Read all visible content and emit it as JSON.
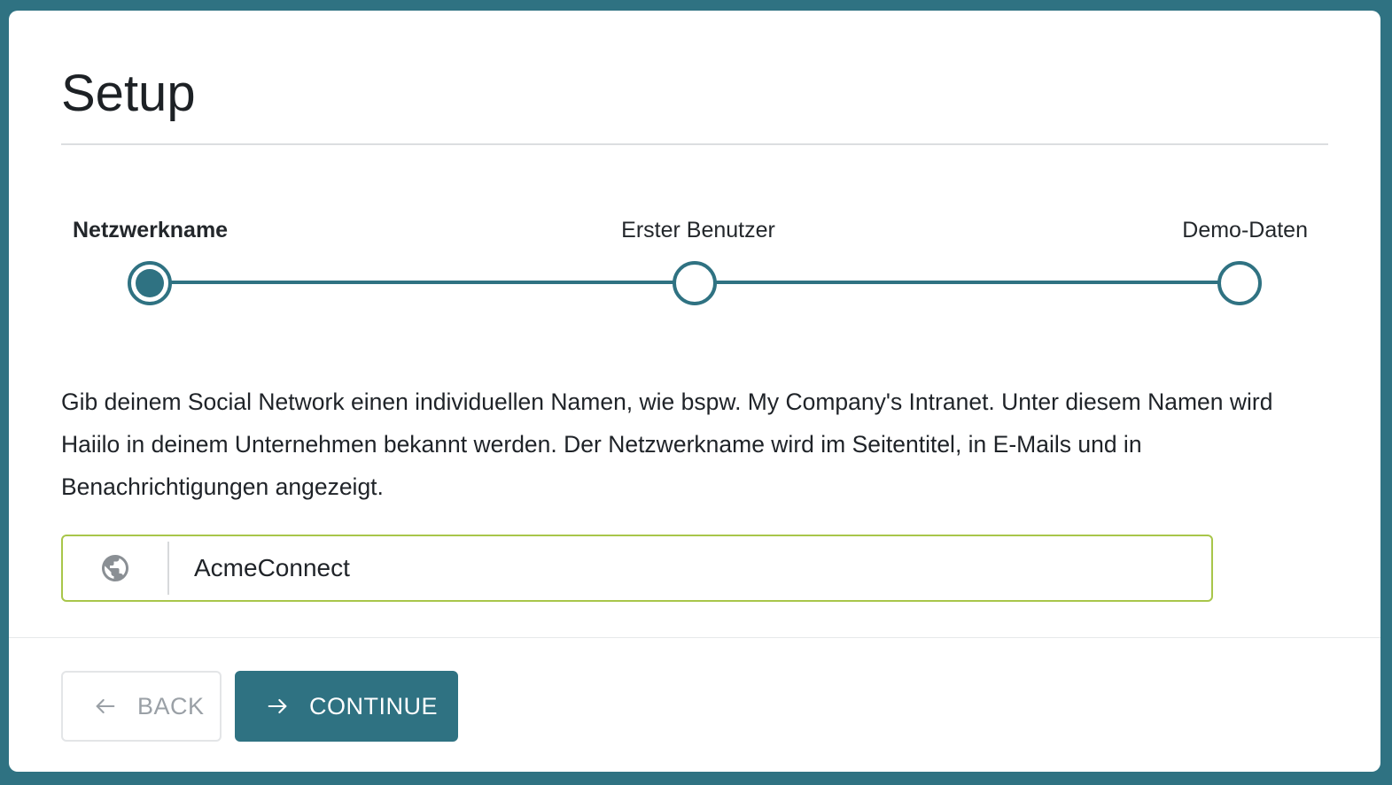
{
  "page": {
    "title": "Setup"
  },
  "stepper": {
    "steps": [
      {
        "label": "Netzwerkname",
        "state": "active"
      },
      {
        "label": "Erster Benutzer",
        "state": "inactive"
      },
      {
        "label": "Demo-Daten",
        "state": "inactive"
      }
    ]
  },
  "content": {
    "description": "Gib deinem Social Network einen individuellen Namen, wie bspw. My Company's Intranet. Unter diesem Namen wird Haiilo in deinem Unternehmen bekannt werden. Der Netzwerkname wird im Seitentitel, in E-Mails und in Benachrichtigungen angezeigt."
  },
  "network_input": {
    "icon": "globe-icon",
    "value": "AcmeConnect"
  },
  "footer": {
    "back_label": "BACK",
    "continue_label": "CONTINUE"
  },
  "colors": {
    "accent": "#2f7282",
    "input_border": "#a8c64a",
    "back_text": "#9aa0a6"
  }
}
